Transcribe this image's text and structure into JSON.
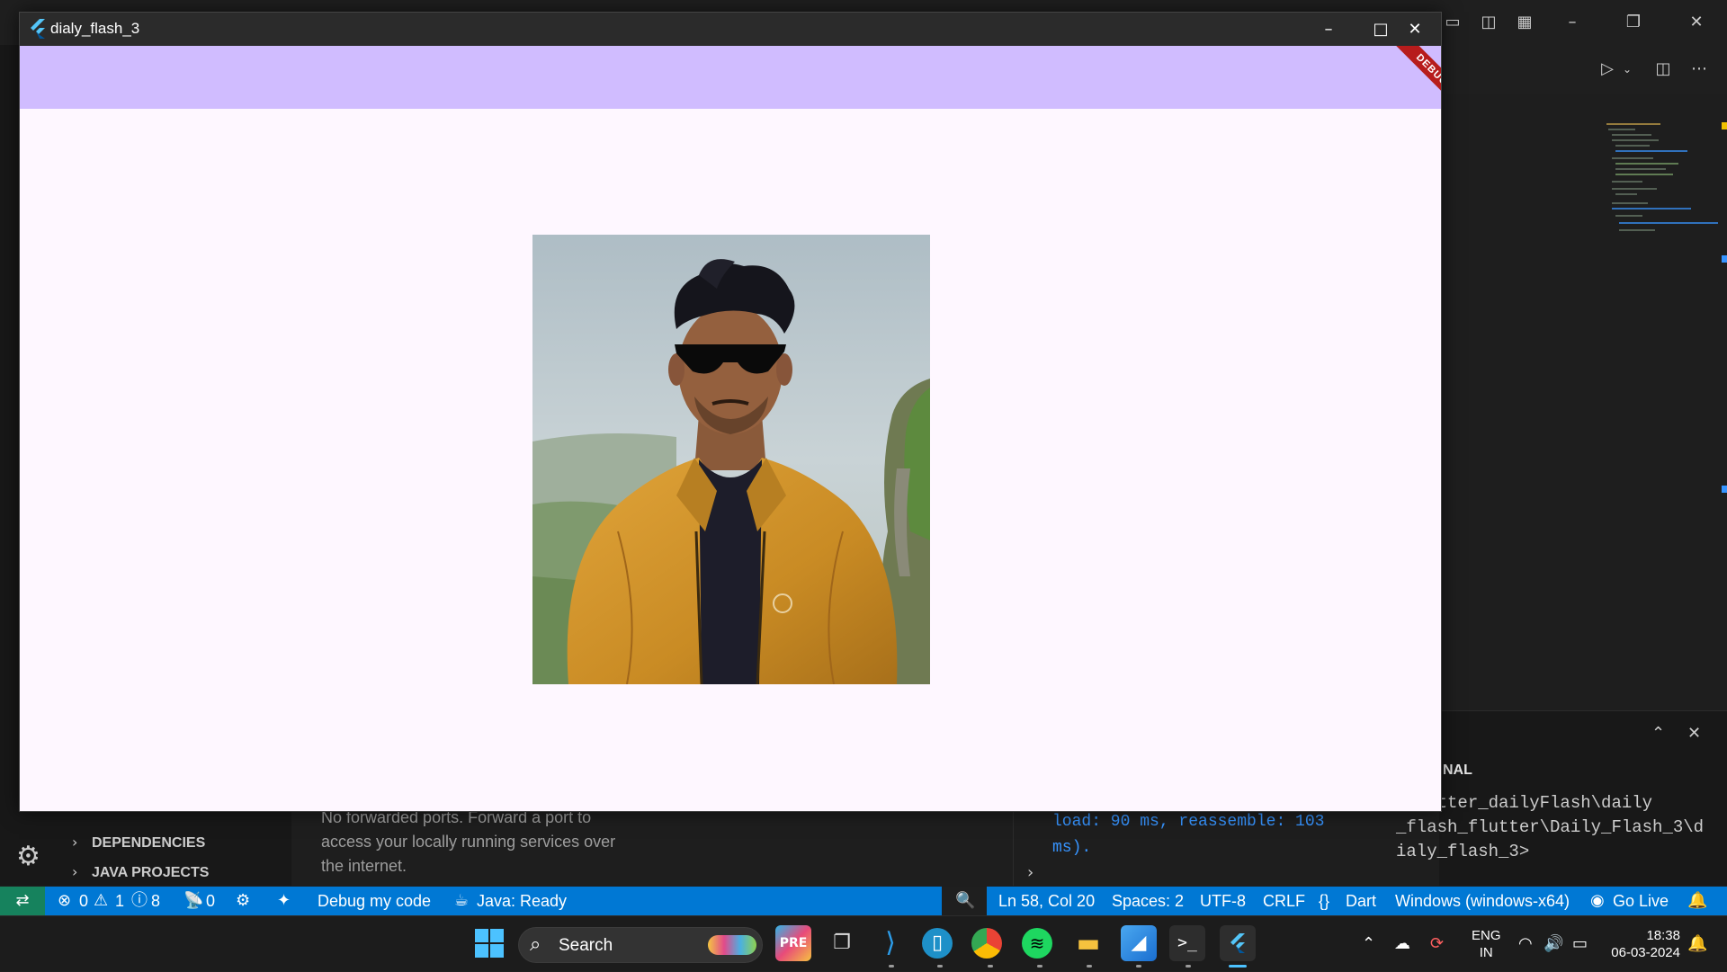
{
  "flutter_window": {
    "title": "dialy_flash_3",
    "debug_banner": "DEBUG",
    "controls": {
      "minimize": "–",
      "maximize": "□",
      "close": "✕"
    }
  },
  "vscode": {
    "panel": {
      "sections": [
        "DEPENDENCIES",
        "JAVA PROJECTS"
      ],
      "ports_message": "No forwarded ports. Forward a port to access your locally running services over the internet.",
      "debug_output": "load: 90 ms, reassemble: 103\nms).",
      "terminal_tab": "NAL",
      "terminal_output": "\\flutter_dailyFlash\\daily\n_flash_flutter\\Daily_Flash_3\\d\nialy_flash_3>"
    },
    "statusbar": {
      "errors": "0",
      "warnings": "1",
      "infos": "8",
      "ports": "0",
      "debug_label": "Debug my code",
      "java_status": "Java: Ready",
      "cursor": "Ln 58, Col 20",
      "spaces": "Spaces: 2",
      "encoding": "UTF-8",
      "eol": "CRLF",
      "language": "Dart",
      "device": "Windows (windows-x64)",
      "go_live": "Go Live"
    }
  },
  "taskbar": {
    "search_label": "Search",
    "language": {
      "line1": "ENG",
      "line2": "IN"
    },
    "time": "18:38",
    "date": "06-03-2024"
  },
  "colors": {
    "appbar": "#d0bcff",
    "statusbar": "#0078d4",
    "debug_banner": "#b71c1c"
  }
}
